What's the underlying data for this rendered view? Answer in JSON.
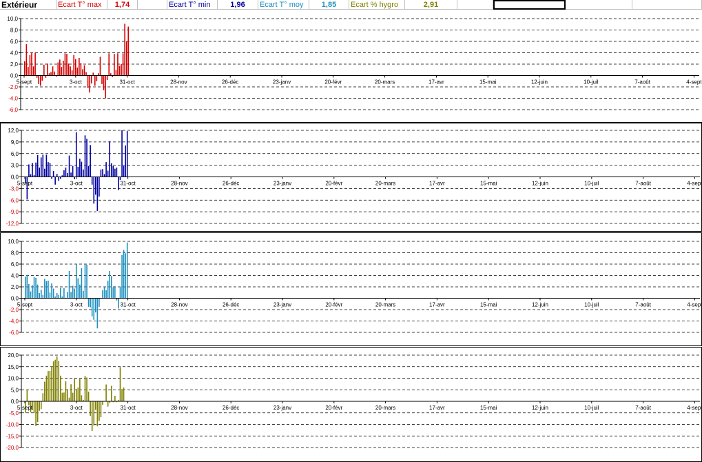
{
  "header": {
    "title": "Extérieur",
    "metrics": [
      {
        "label": "Ecart T° max",
        "value": "1,74",
        "color": "#d40000"
      },
      {
        "label": "Ecart T° min",
        "value": "1,96",
        "color": "#0000a0"
      },
      {
        "label": "Ecart T° moy",
        "value": "1,85",
        "color": "#1e8fbf"
      },
      {
        "label": "Ecart % hygro",
        "value": "2,91",
        "color": "#808000"
      }
    ]
  },
  "chart_data": [
    {
      "type": "bar",
      "series": [
        {
          "color": "#d40000",
          "values": [
            2.5,
            5.5,
            1.5,
            3.6,
            4.0,
            1.6,
            4.0,
            -0.4,
            -1.5,
            -1.8,
            -0.9,
            1.9,
            -0.4,
            2.1,
            0.4,
            0.6,
            1.6,
            0.7,
            -0.2,
            2.3,
            2.8,
            1.5,
            2.6,
            3.9,
            3.8,
            2.1,
            1.6,
            0.9,
            3.6,
            2.9,
            1.4,
            3.1,
            2.2,
            1.1,
            1.8,
            0.6,
            -2.2,
            -3.0,
            -1.4,
            0.5,
            -1.8,
            -1.0,
            0.4,
            3.3,
            -1.5,
            -2.6,
            -4.0,
            -0.8,
            3.9,
            0.4,
            -0.3,
            3.8,
            1.0,
            3.9,
            1.7,
            2.0,
            3.9,
            9.1,
            6.0,
            8.6
          ]
        }
      ],
      "x_ticks": [
        "5-sept",
        "3-oct",
        "31-oct",
        "28-nov",
        "26-déc",
        "23-janv",
        "20-févr",
        "20-mars",
        "17-avr",
        "15-mai",
        "12-juin",
        "10-juil",
        "7-août",
        "4-sept"
      ],
      "y_ticks": [
        "10,0",
        "8,0",
        "6,0",
        "4,0",
        "2,0",
        "0,0",
        "-2,0",
        "-4,0",
        "-6,0"
      ],
      "ylim": [
        -6,
        10
      ],
      "grid": true
    },
    {
      "type": "bar",
      "series": [
        {
          "color": "#0000a0",
          "values": [
            -1.5,
            -5.8,
            3.2,
            0.7,
            3.6,
            0.5,
            3.7,
            5.6,
            2.4,
            5.0,
            5.7,
            2.1,
            5.7,
            3.8,
            3.6,
            -0.5,
            1.5,
            -2.0,
            0.8,
            -1.0,
            -0.5,
            0.4,
            1.7,
            2.4,
            1.0,
            5.5,
            1.1,
            2.8,
            -0.6,
            11.5,
            2.6,
            4.7,
            3.9,
            1.9,
            10.7,
            9.8,
            2.8,
            8.2,
            -2.0,
            -6.9,
            -4.6,
            -8.8,
            -5.1,
            1.9,
            2.0,
            0.7,
            3.8,
            1.6,
            9.2,
            3.5,
            2.8,
            2.1,
            2.4,
            -3.4,
            -0.8,
            12.0,
            2.8,
            8.1,
            11.8
          ]
        }
      ],
      "x_ticks": [
        "5-sept",
        "3-oct",
        "31-oct",
        "28-nov",
        "26-déc",
        "23-janv",
        "20-févr",
        "20-mars",
        "17-avr",
        "15-mai",
        "12-juin",
        "10-juil",
        "7-août",
        "4-sept"
      ],
      "y_ticks": [
        "12,0",
        "9,0",
        "6,0",
        "3,0",
        "0,0",
        "-3,0",
        "-6,0",
        "-9,0",
        "-12,0"
      ],
      "ylim": [
        -12,
        12
      ],
      "grid": true
    },
    {
      "type": "bar",
      "series": [
        {
          "color": "#1e8fbf",
          "values": [
            3.8,
            4.1,
            2.5,
            1.2,
            2.3,
            3.7,
            3.6,
            2.4,
            0.9,
            1.5,
            0.6,
            3.4,
            3.0,
            3.1,
            1.0,
            2.6,
            1.7,
            0.3,
            0.9,
            0.6,
            1.8,
            0.3,
            1.8,
            0.1,
            1.1,
            4.8,
            1.1,
            2.2,
            1.7,
            6.0,
            3.5,
            2.4,
            5.3,
            1.3,
            6.0,
            5.9,
            -1.5,
            -1.6,
            -3.2,
            -3.8,
            -2.5,
            -5.3,
            -1.5,
            -0.1,
            1.4,
            2.0,
            1.4,
            3.1,
            4.8,
            3.9,
            1.9,
            2.1,
            -0.4,
            -1.8,
            2.0,
            7.6,
            8.5,
            7.9,
            9.8
          ]
        }
      ],
      "x_ticks": [
        "5-sept",
        "3-oct",
        "31-oct",
        "28-nov",
        "26-déc",
        "23-janv",
        "20-févr",
        "20-mars",
        "17-avr",
        "15-mai",
        "12-juin",
        "10-juil",
        "7-août",
        "4-sept"
      ],
      "y_ticks": [
        "10,0",
        "8,0",
        "6,0",
        "4,0",
        "2,0",
        "0,0",
        "-2,0",
        "-4,0",
        "-6,0"
      ],
      "ylim": [
        -6,
        10
      ],
      "grid": true
    },
    {
      "type": "bar",
      "series": [
        {
          "color": "#808000",
          "values": [
            -5.0,
            5.0,
            -1.7,
            -4.8,
            -3.8,
            -5.1,
            -10.7,
            -9.0,
            -4.1,
            -3.4,
            3.5,
            8.5,
            11.1,
            13.1,
            13.2,
            15.0,
            17.3,
            18.0,
            19.5,
            17.5,
            11.1,
            3.7,
            3.8,
            8.7,
            5.3,
            1.6,
            7.4,
            3.7,
            9.8,
            5.3,
            6.0,
            9.7,
            2.6,
            0.6,
            11.0,
            10.3,
            4.2,
            -6.3,
            -12.8,
            -10.5,
            -3.7,
            -10.8,
            -8.5,
            -6.9,
            -1.5,
            0.2,
            7.3,
            -2.3,
            -0.7,
            6.7,
            -0.4,
            2.4,
            -0.4,
            0.6,
            14.8,
            5.3,
            6.0
          ]
        }
      ],
      "x_ticks": [
        "5-sept",
        "3-oct",
        "31-oct",
        "28-nov",
        "26-déc",
        "23-janv",
        "20-févr",
        "20-mars",
        "17-avr",
        "15-mai",
        "12-juin",
        "10-juil",
        "7-août",
        "4-sept"
      ],
      "y_ticks": [
        "20,0",
        "15,0",
        "10,0",
        "5,0",
        "0,0",
        "-5,0",
        "-10,0",
        "-15,0",
        "-20,0"
      ],
      "ylim": [
        -20,
        20
      ],
      "grid": true
    }
  ]
}
